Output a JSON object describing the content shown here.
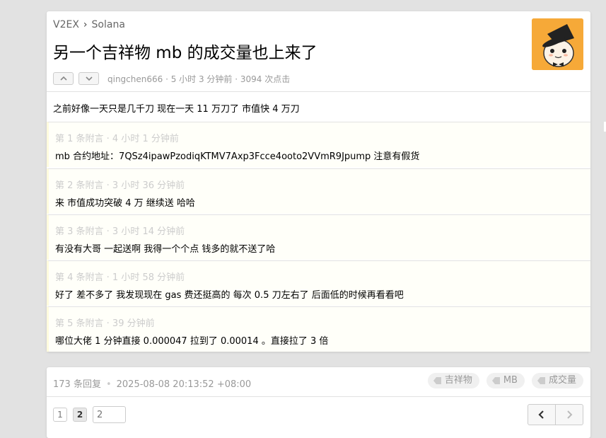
{
  "breadcrumb": {
    "home": "V2EX",
    "separator": "›",
    "node": "Solana"
  },
  "topic": {
    "title": "另一个吉祥物 mb 的成交量也上来了",
    "meta": "qingchen666 · 5 小时 3 分钟前 · 3094 次点击",
    "content": "之前好像一天只是几千刀 现在一天 11 万刀了 市值快 4 万刀",
    "vote_up_icon": "chevron-up-icon",
    "vote_down_icon": "chevron-down-icon",
    "avatar_icon": "top-hat-mascot-icon"
  },
  "appendices": [
    {
      "header": "第 1 条附言 · 4 小时 1 分钟前",
      "body": "mb 合约地址：7QSz4ipawPzodiqKTMV7Axp3Fcce4ooto2VVmR9Jpump 注意有假货"
    },
    {
      "header": "第 2 条附言 · 3 小时 36 分钟前",
      "body": "来 市值成功突破 4 万 继续送 哈哈"
    },
    {
      "header": "第 3 条附言 · 3 小时 14 分钟前",
      "body": "有没有大哥 一起送啊 我得一个个点 钱多的就不送了哈"
    },
    {
      "header": "第 4 条附言 · 1 小时 58 分钟前",
      "body": "好了 差不多了 我发现现在 gas 费还挺高的 每次 0.5 刀左右了 后面低的时候再看看吧"
    },
    {
      "header": "第 5 条附言 · 39 分钟前",
      "body": "哪位大佬 1 分钟直接 0.000047 拉到了 0.00014 。直接拉了 3 倍"
    }
  ],
  "footer": {
    "replies": "173 条回复",
    "separator": "•",
    "timestamp": "2025-08-08 20:13:52 +08:00",
    "tags": [
      "吉祥物",
      "MB",
      "成交量"
    ],
    "pages": [
      "1",
      "2"
    ],
    "page_input_value": "2",
    "prev_icon": "chevron-left-icon",
    "next_icon": "chevron-right-icon"
  }
}
